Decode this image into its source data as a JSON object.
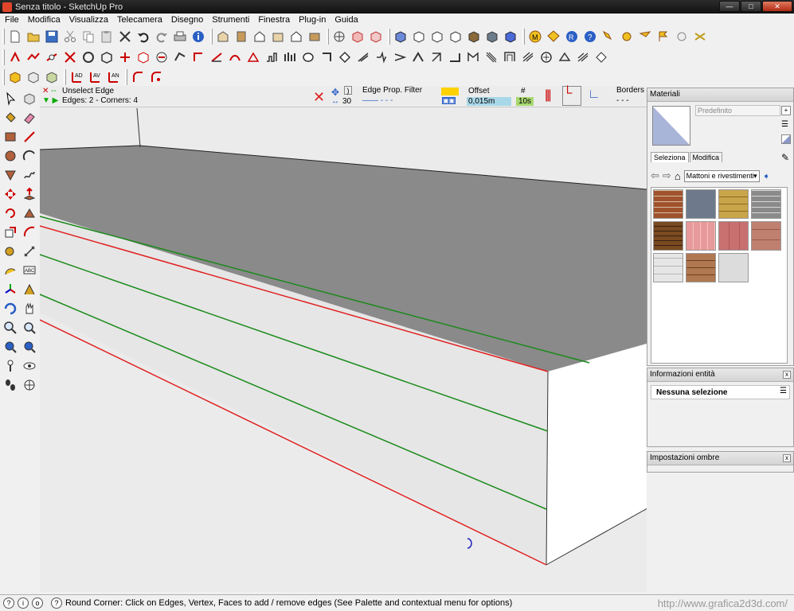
{
  "window": {
    "title": "Senza titolo - SketchUp Pro"
  },
  "menu": [
    "File",
    "Modifica",
    "Visualizza",
    "Telecamera",
    "Disegno",
    "Strumenti",
    "Finestra",
    "Plug-in",
    "Guida"
  ],
  "roundcorner": {
    "line1": "Unselect Edge",
    "line2": "Edges: 2 - Corners: 4",
    "segments": "30",
    "filter_label": "Edge Prop. Filter",
    "offset_label": "Offset",
    "offset_value": "0,015m",
    "count_label": "#",
    "count_value": "10s",
    "borders_label": "Borders",
    "borders_value": "- - -"
  },
  "materials": {
    "title": "Materiali",
    "name_placeholder": "Predefinito",
    "tab_select": "Seleziona",
    "tab_edit": "Modifica",
    "library": "Mattoni e rivestimenti",
    "swatch_colors": [
      "#a0522d",
      "#6e7a8c",
      "#c9a54a",
      "#8a8a8a",
      "#7a4a20",
      "#e89a9a",
      "#c87070",
      "#c08070",
      "#e6e6e6",
      "#b07850",
      "#dcdcdc"
    ]
  },
  "entity_info": {
    "title": "Informazioni entità",
    "value": "Nessuna selezione"
  },
  "shadows": {
    "title": "Impostazioni ombre"
  },
  "statusbar": {
    "message": "Round Corner: Click on Edges, Vertex, Faces to add / remove edges (See Palette and contextual menu for options)",
    "watermark": "http://www.grafica2d3d.com/"
  }
}
